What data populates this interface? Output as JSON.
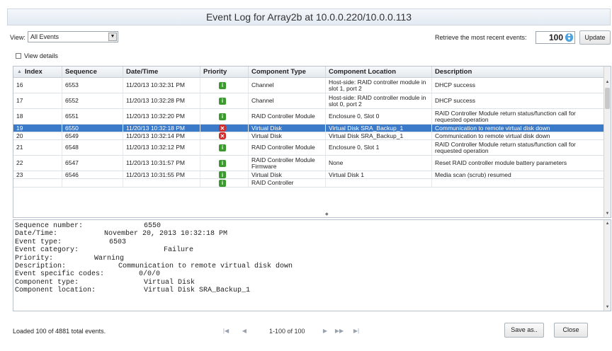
{
  "window": {
    "title": "Event Log for Array2b at 10.0.0.220/10.0.0.113"
  },
  "toolbar": {
    "view_label": "View:",
    "view_value": "All Events",
    "retrieve_label": "Retrieve the most recent events:",
    "retrieve_value": "100",
    "update_label": "Update",
    "view_details_label": "View details"
  },
  "table": {
    "columns": [
      {
        "label": "Index"
      },
      {
        "label": "Sequence"
      },
      {
        "label": "Date/Time"
      },
      {
        "label": "Priority"
      },
      {
        "label": "Component Type"
      },
      {
        "label": "Component Location"
      },
      {
        "label": "Description"
      }
    ],
    "rows": [
      {
        "index": "16",
        "sequence": "6553",
        "datetime": "11/20/13 10:32:31 PM",
        "priority": "info",
        "component_type": "Channel",
        "component_location": "Host-side: RAID controller module in slot 1, port 2",
        "description": "DHCP success",
        "selected": false
      },
      {
        "index": "17",
        "sequence": "6552",
        "datetime": "11/20/13 10:32:28 PM",
        "priority": "info",
        "component_type": "Channel",
        "component_location": "Host-side: RAID controller module in slot 0, port 2",
        "description": "DHCP success",
        "selected": false
      },
      {
        "index": "18",
        "sequence": "6551",
        "datetime": "11/20/13 10:32:20 PM",
        "priority": "info",
        "component_type": "RAID Controller Module",
        "component_location": "Enclosure 0, Slot 0",
        "description": "RAID Controller Module return status/function call for requested operation",
        "selected": false
      },
      {
        "index": "19",
        "sequence": "6550",
        "datetime": "11/20/13 10:32:18 PM",
        "priority": "error",
        "component_type": "Virtual Disk",
        "component_location": "Virtual Disk SRA_Backup_1",
        "description": "Communication to remote virtual disk down",
        "selected": true
      },
      {
        "index": "20",
        "sequence": "6549",
        "datetime": "11/20/13 10:32:14 PM",
        "priority": "error",
        "component_type": "Virtual Disk",
        "component_location": "Virtual Disk SRA_Backup_1",
        "description": "Communication to remote virtual disk down",
        "selected": false
      },
      {
        "index": "21",
        "sequence": "6548",
        "datetime": "11/20/13 10:32:12 PM",
        "priority": "info",
        "component_type": "RAID Controller Module",
        "component_location": "Enclosure 0, Slot 1",
        "description": "RAID Controller Module return status/function call for requested operation",
        "selected": false
      },
      {
        "index": "22",
        "sequence": "6547",
        "datetime": "11/20/13 10:31:57 PM",
        "priority": "info",
        "component_type": "RAID Controller Module Firmware",
        "component_location": "None",
        "description": "Reset RAID controller module battery parameters",
        "selected": false
      },
      {
        "index": "23",
        "sequence": "6546",
        "datetime": "11/20/13 10:31:55 PM",
        "priority": "info",
        "component_type": "Virtual Disk",
        "component_location": "Virtual Disk 1",
        "description": "Media scan (scrub) resumed",
        "selected": false
      },
      {
        "index": "",
        "sequence": "",
        "datetime": "",
        "priority": "info",
        "component_type": "RAID Controller",
        "component_location": "",
        "description": "",
        "selected": false
      }
    ]
  },
  "details": {
    "lines": [
      {
        "label": "Sequence number:",
        "value": "6550"
      },
      {
        "label": "Date/Time:",
        "value": "November 20, 2013 10:32:18 PM"
      },
      {
        "label": "Event type:",
        "value": "6503"
      },
      {
        "label": "Event category:",
        "value": "Failure"
      },
      {
        "label": "Priority:",
        "value": "Warning"
      },
      {
        "label": "Description:",
        "value": "Communication to remote virtual disk down"
      },
      {
        "label": "Event specific codes:",
        "value": "0/0/0"
      },
      {
        "label": "Component type:",
        "value": "Virtual Disk"
      },
      {
        "label": "Component location:",
        "value": "Virtual Disk SRA_Backup_1"
      }
    ]
  },
  "footer": {
    "status": "Loaded 100 of 4881 total events.",
    "page_range": "1-100 of 100",
    "save_label": "Save as..",
    "close_label": "Close"
  },
  "icons": {
    "info": "info-icon",
    "error": "error-icon"
  },
  "colors": {
    "selected_row": "#3a7ac8",
    "info": "#3a9a2e",
    "error": "#d12b2b"
  }
}
